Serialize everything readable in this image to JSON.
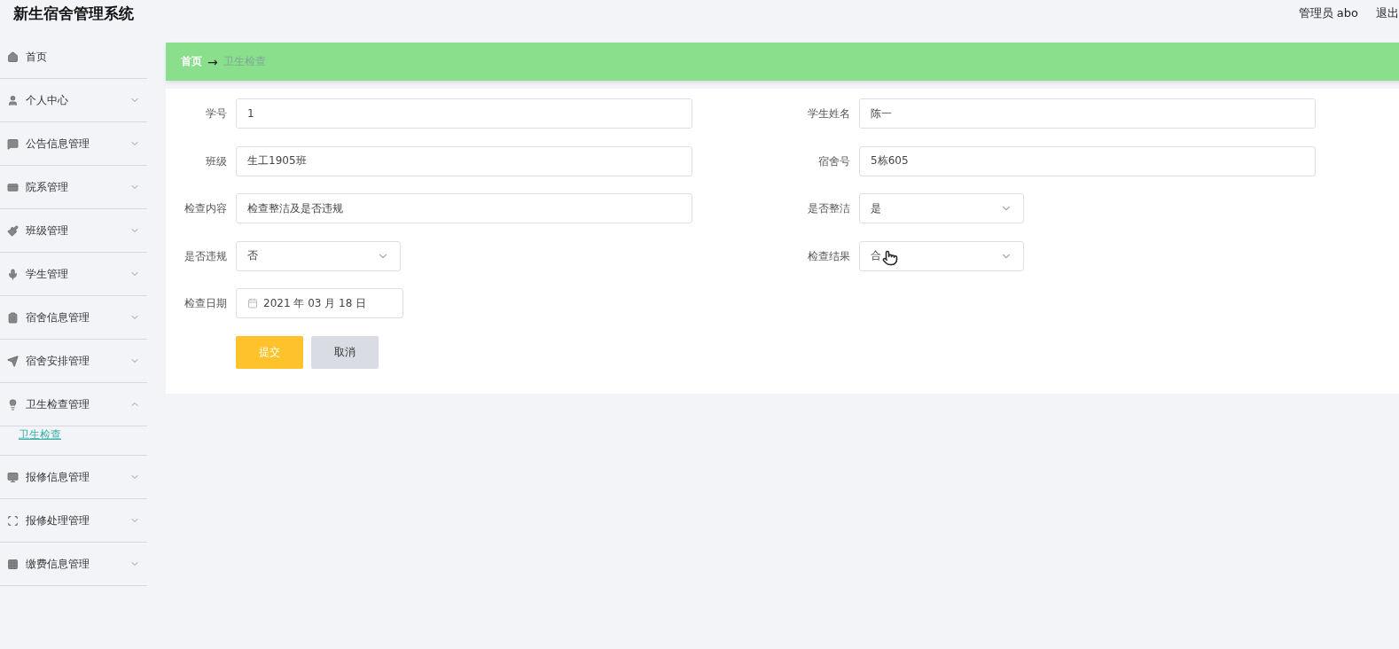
{
  "header": {
    "title": "新生宿舍管理系统",
    "user": "管理员 abo",
    "logout": "退出"
  },
  "sidebar": {
    "items": [
      {
        "label": "首页",
        "kind": "link"
      },
      {
        "label": "个人中心",
        "kind": "menu",
        "expanded": false
      },
      {
        "label": "公告信息管理",
        "kind": "menu",
        "expanded": false
      },
      {
        "label": "院系管理",
        "kind": "menu",
        "expanded": false
      },
      {
        "label": "班级管理",
        "kind": "menu",
        "expanded": false
      },
      {
        "label": "学生管理",
        "kind": "menu",
        "expanded": false
      },
      {
        "label": "宿舍信息管理",
        "kind": "menu",
        "expanded": false
      },
      {
        "label": "宿舍安排管理",
        "kind": "menu",
        "expanded": false
      },
      {
        "label": "卫生检查管理",
        "kind": "menu",
        "expanded": true,
        "children": [
          {
            "label": "卫生检查",
            "selected": true
          }
        ]
      },
      {
        "label": "报修信息管理",
        "kind": "menu",
        "expanded": false
      },
      {
        "label": "报修处理管理",
        "kind": "menu",
        "expanded": false
      },
      {
        "label": "缴费信息管理",
        "kind": "menu",
        "expanded": false
      }
    ]
  },
  "breadcrumb": {
    "home": "首页",
    "separator": "→",
    "current": "卫生检查"
  },
  "form": {
    "rows": [
      [
        {
          "label": "学号",
          "kind": "input",
          "value": "1"
        },
        {
          "label": "学生姓名",
          "kind": "input",
          "value": "陈一"
        }
      ],
      [
        {
          "label": "班级",
          "kind": "input",
          "value": "生工1905班"
        },
        {
          "label": "宿舍号",
          "kind": "input",
          "value": "5栋605"
        }
      ],
      [
        {
          "label": "检查内容",
          "kind": "input",
          "value": "检查整洁及是否违规"
        },
        {
          "label": "是否整洁",
          "kind": "select",
          "value": "是"
        }
      ],
      [
        {
          "label": "是否违规",
          "kind": "select",
          "value": "否"
        },
        {
          "label": "检查结果",
          "kind": "select",
          "value": "合",
          "pointer": true
        }
      ],
      [
        {
          "label": "检查日期",
          "kind": "date",
          "value": "2021 年 03 月 18 日"
        }
      ]
    ],
    "buttons": [
      {
        "label": "提交",
        "kind": "primary"
      },
      {
        "label": "取消",
        "kind": "secondary"
      }
    ]
  }
}
